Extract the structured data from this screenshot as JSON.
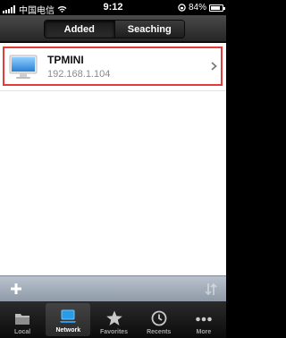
{
  "status_bar": {
    "carrier": "中国电信",
    "time": "9:12",
    "battery_percent": "84%",
    "battery_level": 0.84
  },
  "header": {
    "segments": [
      {
        "label": "Added",
        "active": true
      },
      {
        "label": "Seaching",
        "active": false
      }
    ]
  },
  "devices": [
    {
      "name": "TPMINI",
      "ip": "192.168.1.104",
      "icon": "monitor-icon"
    }
  ],
  "tabs": [
    {
      "label": "Local",
      "icon": "folder-icon",
      "active": false
    },
    {
      "label": "Network",
      "icon": "laptop-icon",
      "active": true
    },
    {
      "label": "Favorites",
      "icon": "star-icon",
      "active": false
    },
    {
      "label": "Recents",
      "icon": "clock-icon",
      "active": false
    },
    {
      "label": "More",
      "icon": "more-icon",
      "active": false
    }
  ],
  "colors": {
    "selection_border": "#e53a3a",
    "active_tab_icon": "#2a9be8"
  }
}
